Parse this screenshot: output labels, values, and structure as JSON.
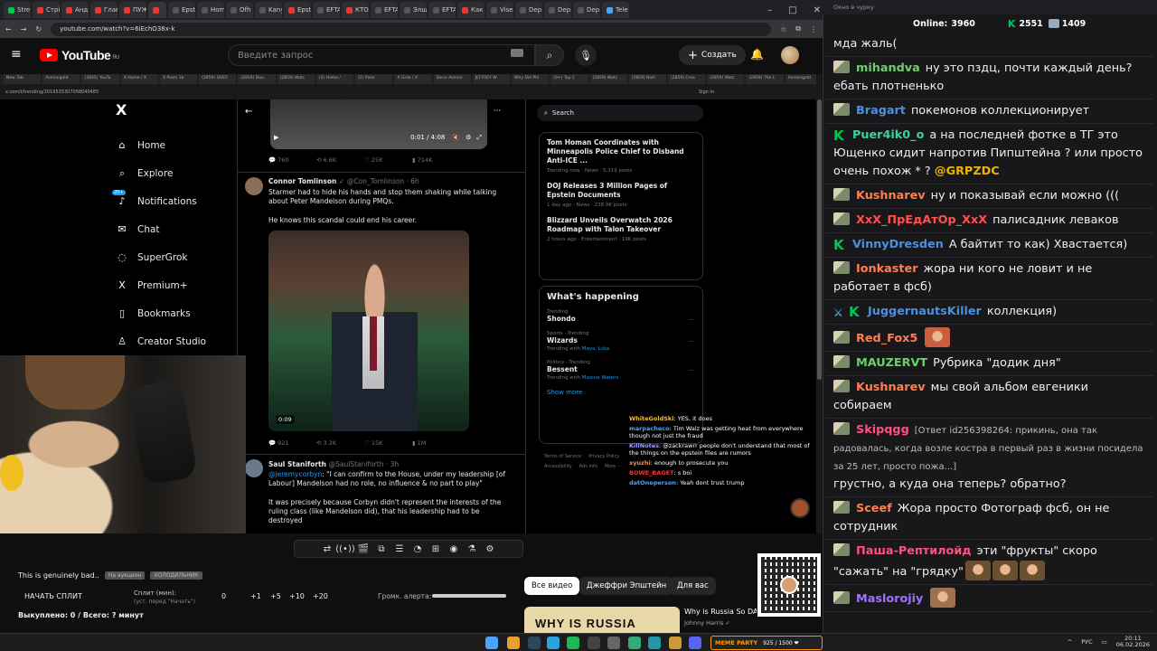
{
  "browser": {
    "tabs": [
      "Stre",
      "Стрі",
      "Анд",
      "Глав",
      "ПУЖ",
      "",
      "Epst",
      "Hom",
      "Ofh",
      "Kany",
      "Epst",
      "EFTA",
      "КТО",
      "EFTA",
      "Элш",
      "EFTA",
      "Как",
      "Vise",
      "Dep",
      "Dep",
      "Dep",
      "Tele"
    ],
    "url": "youtube.com/watch?v=6iEchO38x-k",
    "window_controls": [
      "–",
      "□",
      "✕"
    ]
  },
  "youtube": {
    "logo": "YouTube",
    "region": "RU",
    "search_placeholder": "Введите запрос",
    "create_label": "Создать"
  },
  "inner_browser": {
    "tabs": [
      "New Tab",
      "Asmongold",
      "(3845) YouTu",
      "X Home / X",
      "X Posts 1b",
      "(2859) OVER",
      "(2859) Dou",
      "(2859) Watc",
      "(3) Home /",
      "(2) Polar",
      "X Grok / X",
      "Since Asmon",
      "JEFFREY W",
      "Why Did Phi",
      "(9+) Top C",
      "(2859) Watc",
      "(2859) Nich",
      "(2859) Crea",
      "(2859) Watc",
      "(2859) The L",
      "Asmongold"
    ],
    "url": "x.com/i/trending/2019535307058040485",
    "sign_in": "Sign in"
  },
  "x": {
    "logo": "X",
    "nav": [
      {
        "icon": "home-icon",
        "glyph": "⌂",
        "label": "Home"
      },
      {
        "icon": "explore-icon",
        "glyph": "⌕",
        "label": "Explore"
      },
      {
        "icon": "notifications-icon",
        "glyph": "♪",
        "label": "Notifications",
        "badge": "20+"
      },
      {
        "icon": "chat-icon",
        "glyph": "✉",
        "label": "Chat"
      },
      {
        "icon": "supergrok-icon",
        "glyph": "◌",
        "label": "SuperGrok"
      },
      {
        "icon": "premium-icon",
        "glyph": "X",
        "label": "Premium+"
      },
      {
        "icon": "bookmarks-icon",
        "glyph": "▯",
        "label": "Bookmarks"
      },
      {
        "icon": "creator-studio-icon",
        "glyph": "♙",
        "label": "Creator Studio"
      }
    ],
    "video1": {
      "time": "0:01 / 4:08"
    },
    "post1_actions": [
      "760",
      "6.6K",
      "25K",
      "714K"
    ],
    "post2": {
      "name": "Connor Tomlinson",
      "handle": "@Con_Tomlinson · 6h",
      "text1": "Starmer had to hide his hands and stop them shaking while talking about Peter Mandelson during PMQs.",
      "text2": "He knows this scandal could end his career.",
      "video_time": "0:09",
      "actions": [
        "921",
        "3.2K",
        "15K",
        "1M"
      ]
    },
    "post3": {
      "name": "Saul Staniforth",
      "handle": "@SaulStaniforth · 3h",
      "mention": "@jeremycorbyn",
      "text1": ": \"I can confirm to the House, under my leadership [of Labour] Mandelson had no role, no influence & no part to play\"",
      "text2": "It was precisely because Corbyn didn't represent the interests of the ruling class (like Mandelson did), that his leadership had to be destroyed"
    },
    "search_placeholder": "Search",
    "trends": [
      {
        "title": "Tom Homan Coordinates with Minneapolis Police Chief to Disband Anti-ICE ...",
        "meta": "Trending now · News · 5,319 posts"
      },
      {
        "title": "DOJ Releases 3 Million Pages of Epstein Documents",
        "meta": "1 day ago · News · 238.9K posts"
      },
      {
        "title": "Blizzard Unveils Overwatch 2026 Roadmap with Talon Takeover",
        "meta": "2 hours ago · Entertainment · 19K posts"
      }
    ],
    "happening": {
      "title": "What's happening",
      "items": [
        {
          "cat": "Trending",
          "name": "Shondo",
          "with": "",
          "who": ""
        },
        {
          "cat": "Sports · Trending",
          "name": "Wizards",
          "with": "Trending with ",
          "who": "Mavs, Luka"
        },
        {
          "cat": "Politics · Trending",
          "name": "Bessent",
          "with": "Trending with ",
          "who": "Maxine Waters"
        }
      ],
      "show_more": "Show more"
    },
    "footer": [
      "Terms of Service",
      "Privacy Policy",
      "Accessibility",
      "Ads info",
      "More ···"
    ]
  },
  "mini_chat": [
    {
      "user": "WhiteGoldSki",
      "color": "#f0c040",
      "text": "YES, it does"
    },
    {
      "user": "marpacheco",
      "color": "#4aa3ff",
      "text": "Tim Walz was getting heat from everywhere though not just the fraud"
    },
    {
      "user": "KillNotes",
      "color": "#a0a0ff",
      "text": "@zackrawrr people don't understand that most of the things on the epstein files are rumors"
    },
    {
      "user": "xyuzhi",
      "color": "#ff8c40",
      "text": "enough to prosecute you"
    },
    {
      "user": "BOWE_BAGET",
      "color": "#ff3030",
      "text": "s boi"
    },
    {
      "user": "datOneperson",
      "color": "#4aa3ff",
      "text": "Yeah dont trust trump"
    }
  ],
  "toolbar_icons": [
    "loop-icon",
    "broadcast-icon",
    "clapper-icon",
    "pip-icon",
    "subtitles-icon",
    "speed-icon",
    "plus-box-icon",
    "camera-icon",
    "lab-icon",
    "gear-icon"
  ],
  "toolbar_glyphs": [
    "⇄",
    "((•))",
    "🎬",
    "⧉",
    "☰",
    "◔",
    "⊞",
    "◉",
    "⚗",
    "⚙"
  ],
  "bottom": {
    "alert_title": "This is genuinely bad..",
    "chip1": "На аукцион",
    "chip2": "ХОЛОДИЛЬНИК",
    "split_btn": "НАЧАТЬ СПЛИТ",
    "split_label": "Сплит (мин):",
    "split_sub": "(уст. перед \"Начать\")",
    "steps": [
      "0",
      "+1",
      "+5",
      "+10",
      "+20"
    ],
    "volume_label": "Громк. алерта:",
    "bought": "Выкуплено: 0 / Всего: ? минут"
  },
  "filters": [
    "Все видео",
    "Джеффри Эпштейн",
    "Для вас"
  ],
  "rec_video": {
    "thumb_text": "WHY IS RUSSIA",
    "title": "Why is Russia So DANGEROUS?",
    "channel": "Johnny Harris ✓"
  },
  "chat_window": {
    "title": "Окно в чурку",
    "online_label": "Online:",
    "online": "3960",
    "kick_count": "2551",
    "bag_count": "1409"
  },
  "chat": [
    {
      "badge": "none",
      "nick": "",
      "color": "#fff",
      "text": "мда жаль("
    },
    {
      "badge": "pepe",
      "nick": "mihandva",
      "color": "#6fcf6f",
      "text": "ну это пздц, почти каждый день? ебать плотненько"
    },
    {
      "badge": "pepe",
      "nick": "Bragart",
      "color": "#4a90e2",
      "text": "покемонов коллекционирует"
    },
    {
      "badge": "kick",
      "nick": "Puer4ik0_o",
      "color": "#40d0a0",
      "text": "а на последней фотке в ТГ это Ющенко сидит напротив Пипштейна ? или просто очень похож * ?",
      "mention": "@GRPZDC"
    },
    {
      "badge": "pepe",
      "nick": "Kushnarev",
      "color": "#ff7f50",
      "text": "ну и показывай если можно ((("
    },
    {
      "badge": "pepe",
      "nick": "XxX_ПрЕдАтОр_XxX",
      "color": "#ff5050",
      "text": "палисадник леваков"
    },
    {
      "badge": "kick",
      "nick": "VinnyDresden",
      "color": "#4a90e2",
      "text": "А байтит то как) Хвастается)"
    },
    {
      "badge": "pepe",
      "nick": "Ionkaster",
      "color": "#ff7f50",
      "text": "жора ни кого не ловит и не работает в фсб)"
    },
    {
      "badge": "swordkick",
      "nick": "JuggernautsKiller",
      "color": "#4a90e2",
      "text": "коллекция)"
    },
    {
      "badge": "pepe",
      "nick": "Red_Fox5",
      "color": "#ff7f50",
      "text": "",
      "emotes": [
        "#c86040"
      ]
    },
    {
      "badge": "pepe",
      "nick": "MAUZERVT",
      "color": "#6fcf6f",
      "text": "Рубрика \"додик дня\""
    },
    {
      "badge": "pepe",
      "nick": "Kushnarev",
      "color": "#ff7f50",
      "text": "мы свой альбом евгеники собираем"
    },
    {
      "badge": "pepe",
      "nick": "Skipqgg",
      "color": "#ff5080",
      "reply": "[Ответ id256398264: прикинь, она так радовалась, когда возле костра в первый раз в жизни посидела за 25 лет, просто пожа...]",
      "text": "грустно, а куда она теперь? обратно?"
    },
    {
      "badge": "pepe",
      "nick": "Sceef",
      "color": "#ff7f50",
      "text": "Жора просто Фотограф фсб, он не сотрудник"
    },
    {
      "badge": "pepe",
      "nick": "Паша-Рептилойд",
      "color": "#ff5080",
      "text": "эти \"фрукты\" скоро \"сажать\" на \"грядку\"",
      "emotes": [
        "#6a5030",
        "#6a5030",
        "#6a5030"
      ]
    },
    {
      "badge": "pepe",
      "nick": "Maslorojiy",
      "color": "#a070ff",
      "text": "",
      "emotes": [
        "#a07050"
      ]
    }
  ],
  "taskbar": {
    "meme_label": "MEME PARTY",
    "meme_count": "925 / 1500 ❤",
    "lang": "РУС",
    "time": "20:11",
    "date": "06.02.2026"
  }
}
